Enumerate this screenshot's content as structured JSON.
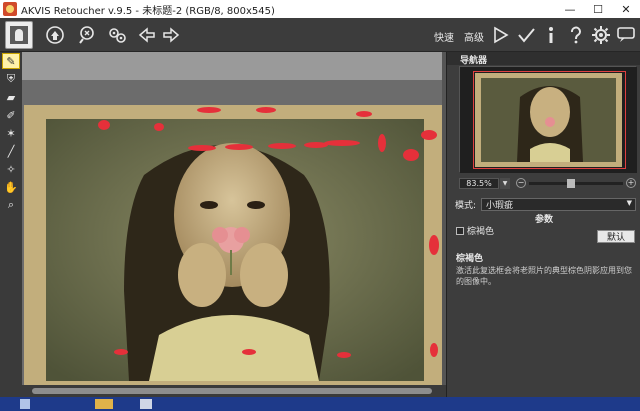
{
  "window": {
    "title": "AKVIS Retoucher v.9.5 - 未标题-2 (RGB/8, 800x545)",
    "controls": [
      "—",
      "☐",
      "✕"
    ]
  },
  "toolbar": {
    "modes": {
      "quick": "快速",
      "advanced": "高级"
    },
    "icons": [
      "open-icon",
      "save-icon",
      "batch-icon",
      "settings-gear-icon",
      "back-icon",
      "forward-icon",
      "run-icon",
      "apply-icon",
      "info-icon",
      "help-icon",
      "preferences-icon",
      "feedback-icon"
    ]
  },
  "tools": [
    "brush-icon",
    "stamp-icon",
    "eraser-icon",
    "pencil-icon",
    "magic-icon",
    "line-icon",
    "wand-icon",
    "hand-icon",
    "zoom-icon"
  ],
  "navigator": {
    "title": "导航器",
    "zoom": "83.5%"
  },
  "settings": {
    "mode_label": "模式:",
    "mode_value": "小瑕疵",
    "params_title": "参数",
    "option_label": "棕褐色",
    "option_checked": false,
    "default_button": "默认"
  },
  "description": {
    "title": "棕褐色",
    "text": "激活此复选框会将老照片的典型棕色阴影应用到您的图像中。"
  },
  "colors": {
    "accent_red": "#e5303a",
    "sepia": "#a88f5a",
    "panel": "#3d3d3d"
  }
}
